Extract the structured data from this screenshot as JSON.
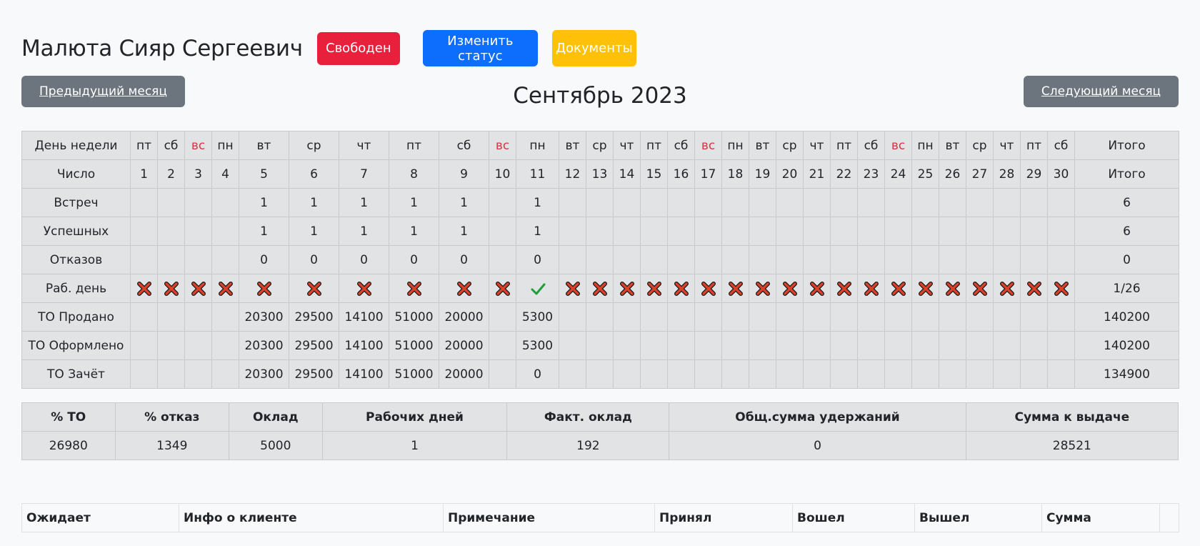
{
  "employee": {
    "name": "Малюта Сияр Сергеевич"
  },
  "buttons": {
    "status": "Свободен",
    "change_status": "Изменить статус",
    "documents": "Документы",
    "prev_month": "Предыдущий месяц",
    "next_month": "Следующий месяц"
  },
  "month_title": "Сентябрь 2023",
  "calendar": {
    "row_labels": {
      "weekday": "День недели",
      "date": "Число",
      "meetings": "Встреч",
      "successful": "Успешных",
      "refusals": "Отказов",
      "workday": "Раб. день",
      "to_sold": "ТО Продано",
      "to_registered": "ТО Оформлено",
      "to_credited": "ТО Зачёт"
    },
    "total_label": "Итого",
    "weekdays": [
      "пт",
      "сб",
      "вс",
      "пн",
      "вт",
      "ср",
      "чт",
      "пт",
      "сб",
      "вс",
      "пн",
      "вт",
      "ср",
      "чт",
      "пт",
      "сб",
      "вс",
      "пн",
      "вт",
      "ср",
      "чт",
      "пт",
      "сб",
      "вс",
      "пн",
      "вт",
      "ср",
      "чт",
      "пт",
      "сб"
    ],
    "dates": [
      "1",
      "2",
      "3",
      "4",
      "5",
      "6",
      "7",
      "8",
      "9",
      "10",
      "11",
      "12",
      "13",
      "14",
      "15",
      "16",
      "17",
      "18",
      "19",
      "20",
      "21",
      "22",
      "23",
      "24",
      "25",
      "26",
      "27",
      "28",
      "29",
      "30"
    ],
    "meetings": [
      "",
      "",
      "",
      "",
      "1",
      "1",
      "1",
      "1",
      "1",
      "",
      "1",
      "",
      "",
      "",
      "",
      "",
      "",
      "",
      "",
      "",
      "",
      "",
      "",
      "",
      "",
      "",
      "",
      "",
      "",
      ""
    ],
    "successful": [
      "",
      "",
      "",
      "",
      "1",
      "1",
      "1",
      "1",
      "1",
      "",
      "1",
      "",
      "",
      "",
      "",
      "",
      "",
      "",
      "",
      "",
      "",
      "",
      "",
      "",
      "",
      "",
      "",
      "",
      "",
      ""
    ],
    "refusals": [
      "",
      "",
      "",
      "",
      "0",
      "0",
      "0",
      "0",
      "0",
      "",
      "0",
      "",
      "",
      "",
      "",
      "",
      "",
      "",
      "",
      "",
      "",
      "",
      "",
      "",
      "",
      "",
      "",
      "",
      "",
      ""
    ],
    "workday": [
      "no",
      "no",
      "no",
      "no",
      "no",
      "no",
      "no",
      "no",
      "no",
      "no",
      "yes",
      "no",
      "no",
      "no",
      "no",
      "no",
      "no",
      "no",
      "no",
      "no",
      "no",
      "no",
      "no",
      "no",
      "no",
      "no",
      "no",
      "no",
      "no",
      "no"
    ],
    "to_sold": [
      "",
      "",
      "",
      "",
      "20300",
      "29500",
      "14100",
      "51000",
      "20000",
      "",
      "5300",
      "",
      "",
      "",
      "",
      "",
      "",
      "",
      "",
      "",
      "",
      "",
      "",
      "",
      "",
      "",
      "",
      "",
      "",
      ""
    ],
    "to_registered": [
      "",
      "",
      "",
      "",
      "20300",
      "29500",
      "14100",
      "51000",
      "20000",
      "",
      "5300",
      "",
      "",
      "",
      "",
      "",
      "",
      "",
      "",
      "",
      "",
      "",
      "",
      "",
      "",
      "",
      "",
      "",
      "",
      ""
    ],
    "to_credited": [
      "",
      "",
      "",
      "",
      "20300",
      "29500",
      "14100",
      "51000",
      "20000",
      "",
      "0",
      "",
      "",
      "",
      "",
      "",
      "",
      "",
      "",
      "",
      "",
      "",
      "",
      "",
      "",
      "",
      "",
      "",
      "",
      ""
    ],
    "totals": {
      "meetings": "6",
      "successful": "6",
      "refusals": "0",
      "workday": "1/26",
      "to_sold": "140200",
      "to_registered": "140200",
      "to_credited": "134900"
    }
  },
  "summary": {
    "headers": [
      "% ТО",
      "% отказ",
      "Оклад",
      "Рабочих дней",
      "Факт. оклад",
      "Общ.сумма удержаний",
      "Сумма к выдаче"
    ],
    "values": [
      "26980",
      "1349",
      "5000",
      "1",
      "192",
      "0",
      "28521"
    ]
  },
  "queue": {
    "headers": [
      "Ожидает",
      "Инфо о клиенте",
      "Примечание",
      "Принял",
      "Вошел",
      "Вышел",
      "Сумма",
      ""
    ]
  },
  "colors": {
    "status": "#e9203b",
    "change": "#0d6efd",
    "docs": "#ffc107",
    "nav": "#6c757d",
    "weekend": "#dc3545",
    "cross": "#d9412b",
    "check": "#1e9e3a"
  }
}
